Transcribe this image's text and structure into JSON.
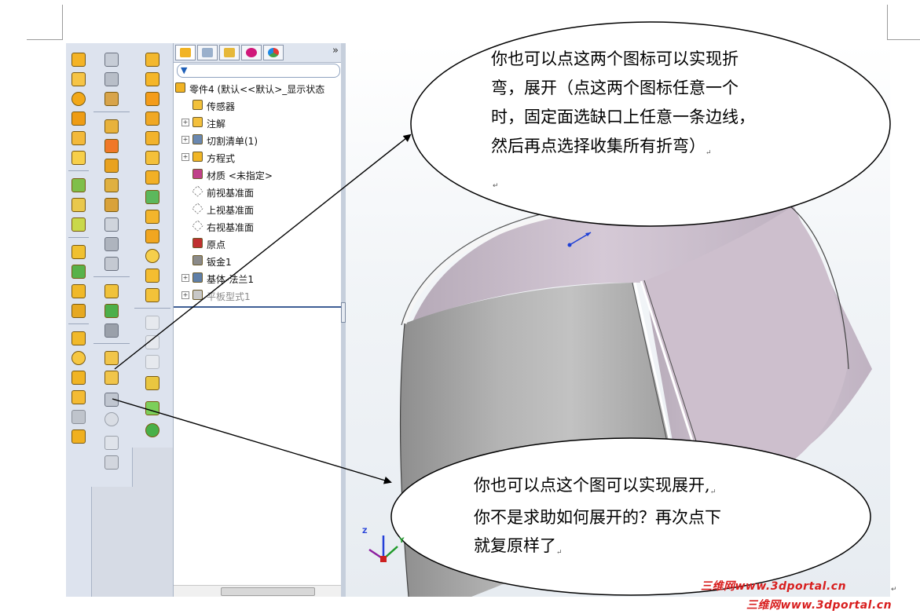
{
  "feature_manager": {
    "tabs": [
      "feature-manager",
      "property-manager",
      "configuration-manager",
      "dimxpert-manager",
      "display-manager"
    ],
    "expand_symbol": "»",
    "filter_icon": "filter-funnel-icon",
    "tree": [
      {
        "label": "零件4 (默认<<默认>_显示状态",
        "icon": "part-icon",
        "expandable": false
      },
      {
        "label": "传感器",
        "icon": "sensor-icon",
        "expandable": false
      },
      {
        "label": "注解",
        "icon": "annotation-icon",
        "expandable": true
      },
      {
        "label": "切割清单(1)",
        "icon": "cut-list-icon",
        "expandable": true
      },
      {
        "label": "方程式",
        "icon": "equation-icon",
        "expandable": true
      },
      {
        "label": "材质 <未指定>",
        "icon": "material-icon",
        "expandable": false
      },
      {
        "label": "前视基准面",
        "icon": "plane-icon",
        "expandable": false
      },
      {
        "label": "上视基准面",
        "icon": "plane-icon",
        "expandable": false
      },
      {
        "label": "右视基准面",
        "icon": "plane-icon",
        "expandable": false
      },
      {
        "label": "原点",
        "icon": "origin-icon",
        "expandable": false
      },
      {
        "label": "钣金1",
        "icon": "sheet-metal-icon",
        "expandable": false
      },
      {
        "label": "基体-法兰1",
        "icon": "base-flange-icon",
        "expandable": true
      },
      {
        "label": "平板型式1",
        "icon": "flat-pattern-icon",
        "expandable": true,
        "suppressed": true
      }
    ]
  },
  "callouts": {
    "top": {
      "lines": [
        "你也可以点这两个图标可以实现折",
        "弯，展开（点这两个图标任意一个",
        "时，固定面选缺口上任意一条边线，",
        "然后再点选择收集所有折弯）"
      ],
      "mark_after": "↵",
      "empty_mark": "↵"
    },
    "bottom": {
      "lines": [
        "你也可以点这个图可以实现展开,",
        "你不是求助如何展开的？再次点下",
        "就复原样了"
      ],
      "marks": [
        "↵",
        "",
        "↵"
      ]
    }
  },
  "triad": {
    "x": "Y",
    "y": "Y",
    "z": "Z"
  },
  "watermarks": [
    "三维网www.3dportal.cn",
    "三维网www.3dportal.cn"
  ],
  "doc_marks": {
    "page_end": "↵"
  },
  "colors": {
    "toolbar_bg": "#dde3ee",
    "icon_yellow": "#f2b21c",
    "cylinder_outer": "#9e9e9e",
    "cylinder_inner": "#c9bcc9",
    "watermark": "#d81e1e"
  }
}
